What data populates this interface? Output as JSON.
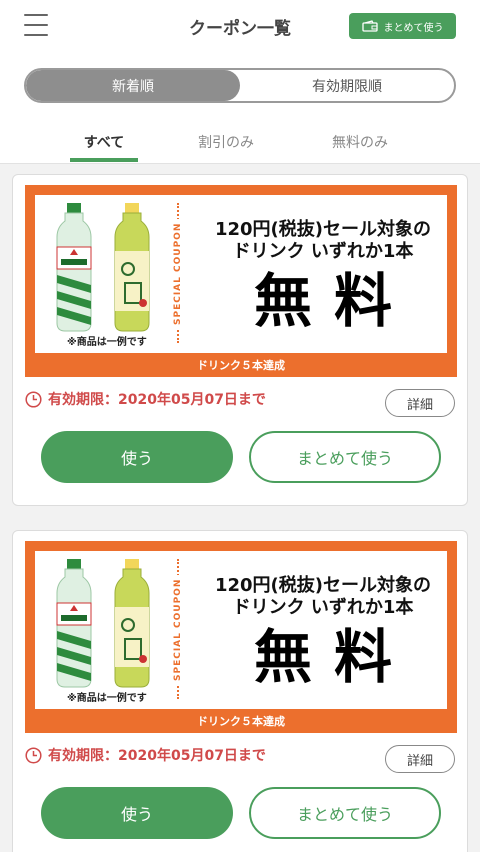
{
  "header": {
    "title": "クーポン一覧",
    "bulk_use_label": "まとめて使う",
    "menu_icon": "hamburger-icon",
    "wallet_icon": "wallet-icon"
  },
  "sort_toggle": {
    "options": [
      "新着順",
      "有効期限順"
    ],
    "selected": "新着順"
  },
  "filter_tabs": {
    "items": [
      "すべて",
      "割引のみ",
      "無料のみ"
    ],
    "selected": "すべて"
  },
  "colors": {
    "brand_green": "#4a9e5c",
    "coupon_orange": "#ec6f2d",
    "expiry_red": "#d04a4a"
  },
  "coupons": [
    {
      "special_label": "SPECIAL COUPON",
      "description_line1": "120円(税抜)セール対象の",
      "description_line2": "ドリンク いずれか1本",
      "offer": "無料",
      "example_note": "※商品は一例です",
      "condition": "ドリンク５本達成",
      "expiry_text": "有効期限：2020年05月07日まで",
      "detail_label": "詳細",
      "use_label": "使う",
      "bulk_use_label": "まとめて使う",
      "products": [
        "MITSUYA CIDER",
        "お〜い お茶"
      ]
    },
    {
      "special_label": "SPECIAL COUPON",
      "description_line1": "120円(税抜)セール対象の",
      "description_line2": "ドリンク いずれか1本",
      "offer": "無料",
      "example_note": "※商品は一例です",
      "condition": "ドリンク５本達成",
      "expiry_text": "有効期限：2020年05月07日まで",
      "detail_label": "詳細",
      "use_label": "使う",
      "bulk_use_label": "まとめて使う",
      "products": [
        "MITSUYA CIDER",
        "お〜い お茶"
      ]
    }
  ]
}
